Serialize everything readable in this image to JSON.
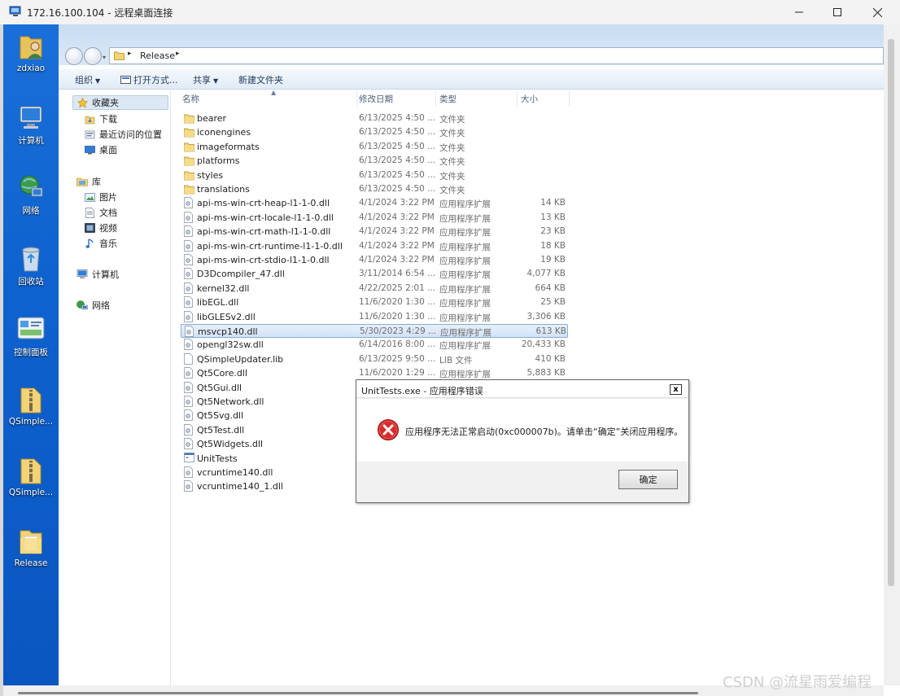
{
  "rdp": {
    "title": "172.16.100.104 - 远程桌面连接"
  },
  "desktop_icons": [
    {
      "label": "zdxiao",
      "icon": "user-folder-icon"
    },
    {
      "label": "计算机",
      "icon": "computer-icon"
    },
    {
      "label": "网络",
      "icon": "network-icon"
    },
    {
      "label": "回收站",
      "icon": "recycle-bin-icon"
    },
    {
      "label": "控制面板",
      "icon": "control-panel-icon"
    },
    {
      "label": "QSimple...",
      "icon": "folder-zip-icon"
    },
    {
      "label": "QSimple...",
      "icon": "folder-zip-icon"
    },
    {
      "label": "Release",
      "icon": "folder-icon"
    }
  ],
  "explorer": {
    "address": {
      "current": "Release"
    },
    "toolbar": {
      "organize": "组织",
      "open_with": "打开方式...",
      "share": "共享",
      "new_folder": "新建文件夹"
    },
    "nav": {
      "favorites": "收藏夹",
      "downloads": "下载",
      "recent": "最近访问的位置",
      "desktop": "桌面",
      "libraries": "库",
      "pictures": "图片",
      "documents": "文档",
      "videos": "视频",
      "music": "音乐",
      "computer": "计算机",
      "network": "网络"
    },
    "columns": {
      "name": "名称",
      "date": "修改日期",
      "type": "类型",
      "size": "大小"
    },
    "files": [
      {
        "name": "bearer",
        "date": "6/13/2025 4:50 ...",
        "type": "文件夹",
        "size": "",
        "kind": "folder"
      },
      {
        "name": "iconengines",
        "date": "6/13/2025 4:50 ...",
        "type": "文件夹",
        "size": "",
        "kind": "folder"
      },
      {
        "name": "imageformats",
        "date": "6/13/2025 4:50 ...",
        "type": "文件夹",
        "size": "",
        "kind": "folder"
      },
      {
        "name": "platforms",
        "date": "6/13/2025 4:50 ...",
        "type": "文件夹",
        "size": "",
        "kind": "folder"
      },
      {
        "name": "styles",
        "date": "6/13/2025 4:50 ...",
        "type": "文件夹",
        "size": "",
        "kind": "folder"
      },
      {
        "name": "translations",
        "date": "6/13/2025 4:50 ...",
        "type": "文件夹",
        "size": "",
        "kind": "folder"
      },
      {
        "name": "api-ms-win-crt-heap-l1-1-0.dll",
        "date": "4/1/2024 3:22 PM",
        "type": "应用程序扩展",
        "size": "14 KB",
        "kind": "dll"
      },
      {
        "name": "api-ms-win-crt-locale-l1-1-0.dll",
        "date": "4/1/2024 3:22 PM",
        "type": "应用程序扩展",
        "size": "13 KB",
        "kind": "dll"
      },
      {
        "name": "api-ms-win-crt-math-l1-1-0.dll",
        "date": "4/1/2024 3:22 PM",
        "type": "应用程序扩展",
        "size": "23 KB",
        "kind": "dll"
      },
      {
        "name": "api-ms-win-crt-runtime-l1-1-0.dll",
        "date": "4/1/2024 3:22 PM",
        "type": "应用程序扩展",
        "size": "18 KB",
        "kind": "dll"
      },
      {
        "name": "api-ms-win-crt-stdio-l1-1-0.dll",
        "date": "4/1/2024 3:22 PM",
        "type": "应用程序扩展",
        "size": "19 KB",
        "kind": "dll"
      },
      {
        "name": "D3Dcompiler_47.dll",
        "date": "3/11/2014 6:54 ...",
        "type": "应用程序扩展",
        "size": "4,077 KB",
        "kind": "dll"
      },
      {
        "name": "kernel32.dll",
        "date": "4/22/2025 2:01 ...",
        "type": "应用程序扩展",
        "size": "664 KB",
        "kind": "dll"
      },
      {
        "name": "libEGL.dll",
        "date": "11/6/2020 1:30 ...",
        "type": "应用程序扩展",
        "size": "25 KB",
        "kind": "dll"
      },
      {
        "name": "libGLESv2.dll",
        "date": "11/6/2020 1:30 ...",
        "type": "应用程序扩展",
        "size": "3,306 KB",
        "kind": "dll"
      },
      {
        "name": "msvcp140.dll",
        "date": "5/30/2023 4:29 ...",
        "type": "应用程序扩展",
        "size": "613 KB",
        "kind": "dll",
        "selected": true
      },
      {
        "name": "opengl32sw.dll",
        "date": "6/14/2016 8:00 ...",
        "type": "应用程序扩展",
        "size": "20,433 KB",
        "kind": "dll"
      },
      {
        "name": "QSimpleUpdater.lib",
        "date": "6/13/2025 9:50 ...",
        "type": "LIB 文件",
        "size": "410 KB",
        "kind": "lib"
      },
      {
        "name": "Qt5Core.dll",
        "date": "11/6/2020 1:29 ...",
        "type": "应用程序扩展",
        "size": "5,883 KB",
        "kind": "dll"
      },
      {
        "name": "Qt5Gui.dll",
        "date": "",
        "type": "",
        "size": "",
        "kind": "dll"
      },
      {
        "name": "Qt5Network.dll",
        "date": "",
        "type": "",
        "size": "",
        "kind": "dll"
      },
      {
        "name": "Qt5Svg.dll",
        "date": "",
        "type": "",
        "size": "",
        "kind": "dll"
      },
      {
        "name": "Qt5Test.dll",
        "date": "",
        "type": "",
        "size": "",
        "kind": "dll"
      },
      {
        "name": "Qt5Widgets.dll",
        "date": "",
        "type": "",
        "size": "",
        "kind": "dll"
      },
      {
        "name": "UnitTests",
        "date": "",
        "type": "",
        "size": "",
        "kind": "exe"
      },
      {
        "name": "vcruntime140.dll",
        "date": "",
        "type": "",
        "size": "",
        "kind": "dll"
      },
      {
        "name": "vcruntime140_1.dll",
        "date": "",
        "type": "",
        "size": "",
        "kind": "dll"
      }
    ]
  },
  "dialog": {
    "title": "UnitTests.exe - 应用程序错误",
    "close": "x",
    "message": "应用程序无法正常启动(0xc000007b)。请单击“确定”关闭应用程序。",
    "ok": "确定"
  },
  "watermark": "CSDN @流星雨爱编程"
}
